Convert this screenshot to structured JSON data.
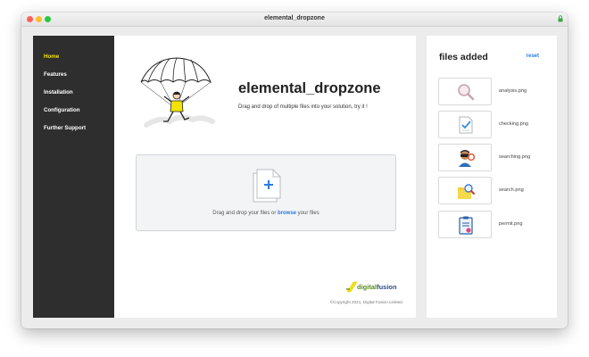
{
  "window": {
    "title": "elemental_dropzone"
  },
  "sidebar": {
    "items": [
      {
        "label": "Home",
        "active": true
      },
      {
        "label": "Features"
      },
      {
        "label": "Installation"
      },
      {
        "label": "Configuration"
      },
      {
        "label": "Further Support"
      }
    ]
  },
  "main": {
    "title": "elemental_dropzone",
    "subtitle": "Drag and drop of multiple files into your solution, try it !",
    "dropzone": {
      "text_before": "Drag and drop your files or ",
      "browse": "browse",
      "text_after": " your files"
    },
    "brand": {
      "part1": "digital",
      "part2": "fusion"
    },
    "copyright": "©Copyright 2021, Digital Fusion Limited."
  },
  "files_panel": {
    "title": "files added",
    "reset": "reset",
    "files": [
      {
        "name": "analysis.png",
        "icon": "magnifier-icon"
      },
      {
        "name": "checking.png",
        "icon": "checklist-icon"
      },
      {
        "name": "searching.png",
        "icon": "person-search-icon"
      },
      {
        "name": "search.png",
        "icon": "folder-search-icon"
      },
      {
        "name": "permit.png",
        "icon": "permit-document-icon"
      }
    ]
  },
  "colors": {
    "sidebar_bg": "#2e2e2e",
    "nav_active": "#f2e400",
    "link": "#2a7ae2",
    "brand_green": "#5a8a1e",
    "brand_blue": "#2c4a8a"
  }
}
